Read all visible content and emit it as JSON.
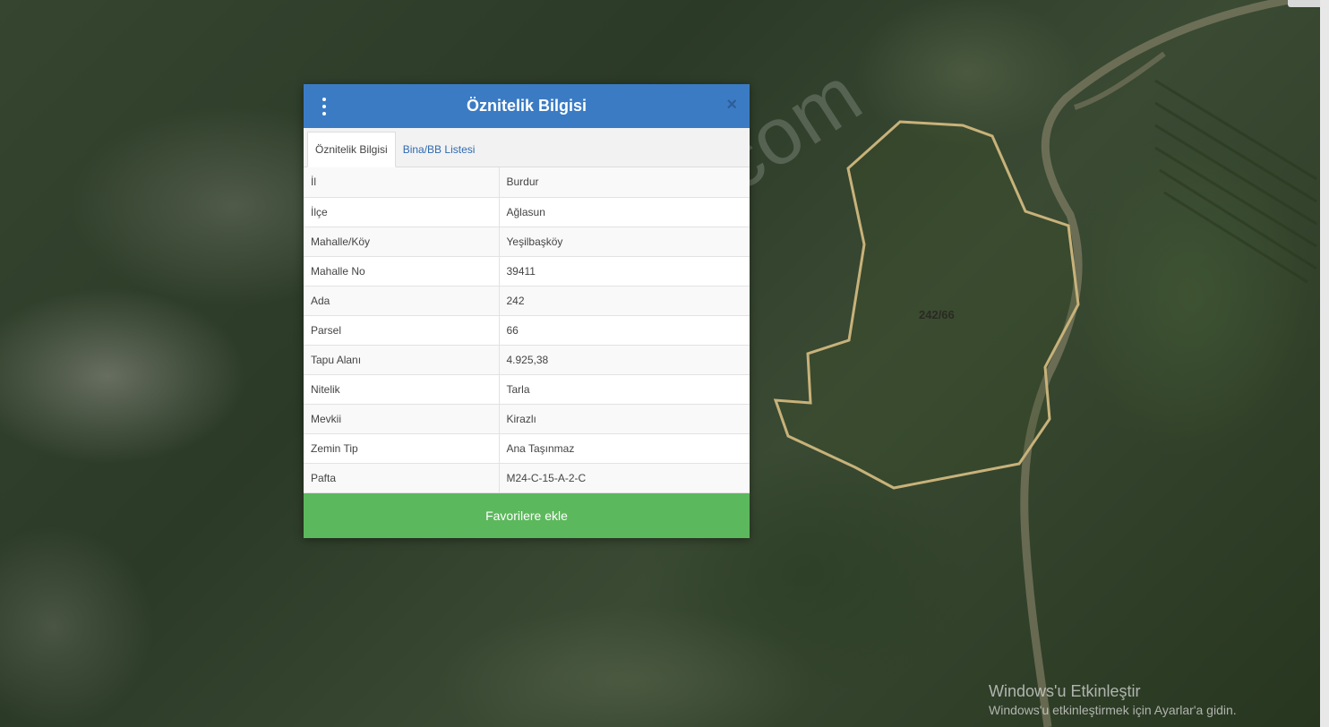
{
  "map": {
    "parcel_label": "242/66",
    "watermark": "emlakjet.com",
    "parcel_outline_color": "#c8b27a"
  },
  "modal": {
    "title": "Öznitelik Bilgisi",
    "menu_icon": "kebab-menu-icon",
    "close_icon": "close-icon",
    "close_label": "×",
    "header_color": "#3b7bc4",
    "tabs": [
      {
        "label": "Öznitelik Bilgisi",
        "active": true
      },
      {
        "label": "Bina/BB Listesi",
        "active": false
      }
    ],
    "rows": [
      {
        "key": "İl",
        "value": "Burdur"
      },
      {
        "key": "İlçe",
        "value": "Ağlasun"
      },
      {
        "key": "Mahalle/Köy",
        "value": "Yeşilbaşköy"
      },
      {
        "key": "Mahalle No",
        "value": "39411"
      },
      {
        "key": "Ada",
        "value": "242"
      },
      {
        "key": "Parsel",
        "value": "66"
      },
      {
        "key": "Tapu Alanı",
        "value": "4.925,38"
      },
      {
        "key": "Nitelik",
        "value": "Tarla"
      },
      {
        "key": "Mevkii",
        "value": "Kirazlı"
      },
      {
        "key": "Zemin Tip",
        "value": "Ana Taşınmaz"
      },
      {
        "key": "Pafta",
        "value": "M24-C-15-A-2-C"
      }
    ],
    "favorite_button": "Favorilere ekle",
    "favorite_color": "#5cb85c"
  },
  "windows_notice": {
    "title": "Windows'u Etkinleştir",
    "subtitle": "Windows'u etkinleştirmek için Ayarlar'a gidin."
  }
}
